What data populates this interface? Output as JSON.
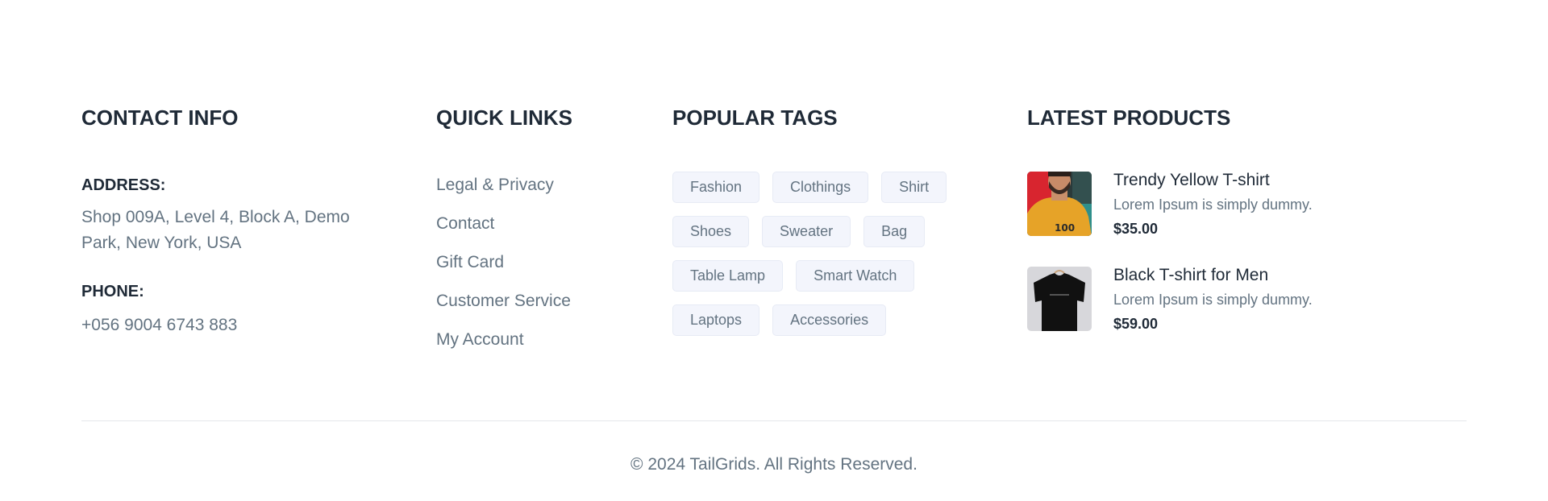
{
  "contact": {
    "heading": "CONTACT INFO",
    "address_label": "ADDRESS:",
    "address_value": "Shop 009A, Level 4, Block A, Demo Park, New York, USA",
    "phone_label": "PHONE:",
    "phone_value": "+056 9004 6743 883"
  },
  "quick_links": {
    "heading": "QUICK LINKS",
    "items": [
      {
        "label": "Legal & Privacy"
      },
      {
        "label": "Contact"
      },
      {
        "label": "Gift Card"
      },
      {
        "label": "Customer Service"
      },
      {
        "label": "My Account"
      }
    ]
  },
  "popular_tags": {
    "heading": "POPULAR TAGS",
    "items": [
      {
        "label": "Fashion"
      },
      {
        "label": "Clothings"
      },
      {
        "label": "Shirt"
      },
      {
        "label": "Shoes"
      },
      {
        "label": "Sweater"
      },
      {
        "label": "Bag"
      },
      {
        "label": "Table Lamp"
      },
      {
        "label": "Smart Watch"
      },
      {
        "label": "Laptops"
      },
      {
        "label": "Accessories"
      }
    ]
  },
  "latest_products": {
    "heading": "LATEST PRODUCTS",
    "items": [
      {
        "name": "Trendy Yellow T-shirt",
        "description": "Lorem Ipsum is simply dummy.",
        "price": "$35.00",
        "image": "yellow-tshirt-photo"
      },
      {
        "name": "Black T-shirt for Men",
        "description": "Lorem Ipsum is simply dummy.",
        "price": "$59.00",
        "image": "black-tshirt-photo"
      }
    ]
  },
  "copyright": "© 2024 TailGrids. All Rights Reserved.",
  "colors": {
    "heading": "#1f2a37",
    "body_text": "#637381",
    "tag_bg": "#f3f5fc",
    "tag_border": "#e7ebf5",
    "divider": "#e5e7eb"
  }
}
